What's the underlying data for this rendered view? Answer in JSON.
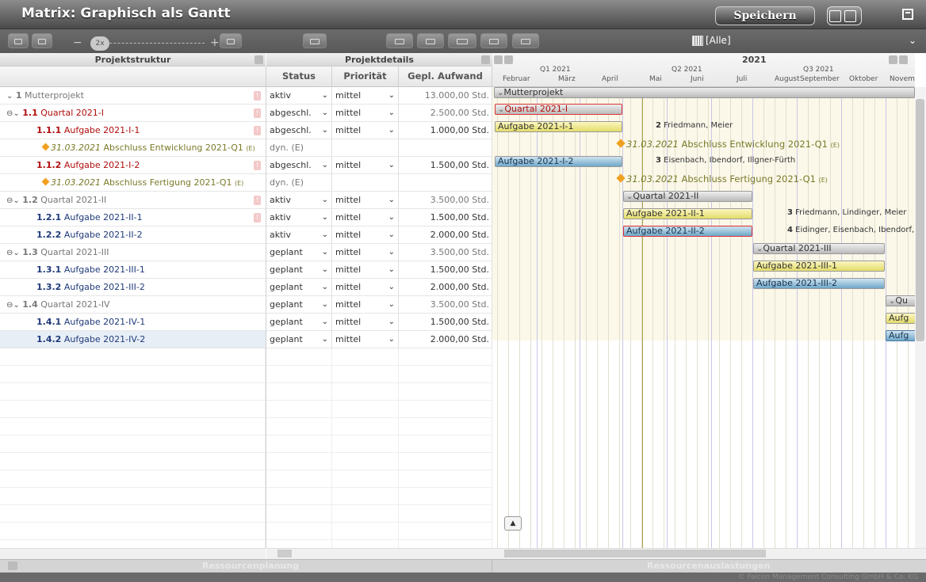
{
  "app": {
    "title": "Matrix: Graphisch als Gantt",
    "save_label": "Speichern",
    "filter_value": "[Alle]",
    "zoom_label": "2x",
    "zoom_minus": "−",
    "zoom_plus": "+"
  },
  "panels": {
    "structure_title": "Projektstruktur",
    "details_title": "Projektdetails",
    "year_label": "2021"
  },
  "columns": {
    "status": "Status",
    "priority": "Priorität",
    "effort": "Gepl. Aufwand"
  },
  "timeline": {
    "quarters": [
      "Q1 2021",
      "Q2 2021",
      "Q3 2021"
    ],
    "months": [
      "Februar",
      "März",
      "April",
      "Mai",
      "Juni",
      "Juli",
      "August",
      "September",
      "Oktober",
      "Novem"
    ]
  },
  "rows": [
    {
      "num": "1",
      "label": "Mutterprojekt",
      "status": "aktiv",
      "priority": "mittel",
      "effort": "13.000,00 Std."
    },
    {
      "num": "1.1",
      "label": "Quartal 2021-I",
      "status": "abgeschl.",
      "priority": "mittel",
      "effort": "2.500,00 Std."
    },
    {
      "num": "1.1.1",
      "label": "Aufgabe 2021-I-1",
      "status": "abgeschl.",
      "priority": "mittel",
      "effort": "1.000,00 Std."
    },
    {
      "date": "31.03.2021",
      "label": "Abschluss Entwicklung 2021-Q1",
      "suffix": "(E)",
      "status": "dyn. (E)"
    },
    {
      "num": "1.1.2",
      "label": "Aufgabe 2021-I-2",
      "status": "abgeschl.",
      "priority": "mittel",
      "effort": "1.500,00 Std."
    },
    {
      "date": "31.03.2021",
      "label": "Abschluss Fertigung 2021-Q1",
      "suffix": "(E)",
      "status": "dyn. (E)"
    },
    {
      "num": "1.2",
      "label": "Quartal 2021-II",
      "status": "aktiv",
      "priority": "mittel",
      "effort": "3.500,00 Std."
    },
    {
      "num": "1.2.1",
      "label": "Aufgabe 2021-II-1",
      "status": "aktiv",
      "priority": "mittel",
      "effort": "1.500,00 Std."
    },
    {
      "num": "1.2.2",
      "label": "Aufgabe 2021-II-2",
      "status": "aktiv",
      "priority": "mittel",
      "effort": "2.000,00 Std."
    },
    {
      "num": "1.3",
      "label": "Quartal 2021-III",
      "status": "geplant",
      "priority": "mittel",
      "effort": "3.500,00 Std."
    },
    {
      "num": "1.3.1",
      "label": "Aufgabe 2021-III-1",
      "status": "geplant",
      "priority": "mittel",
      "effort": "1.500,00 Std."
    },
    {
      "num": "1.3.2",
      "label": "Aufgabe 2021-III-2",
      "status": "geplant",
      "priority": "mittel",
      "effort": "2.000,00 Std."
    },
    {
      "num": "1.4",
      "label": "Quartal 2021-IV",
      "status": "geplant",
      "priority": "mittel",
      "effort": "3.500,00 Std."
    },
    {
      "num": "1.4.1",
      "label": "Aufgabe 2021-IV-1",
      "status": "geplant",
      "priority": "mittel",
      "effort": "1.500,00 Std."
    },
    {
      "num": "1.4.2",
      "label": "Aufgabe 2021-IV-2",
      "status": "geplant",
      "priority": "mittel",
      "effort": "2.000,00 Std."
    }
  ],
  "gantt": {
    "bars": {
      "mutter": "Mutterprojekt",
      "q1": "Quartal 2021-I",
      "a111": "Aufgabe 2021-I-1",
      "a112": "Aufgabe 2021-I-2",
      "q2": "Quartal 2021-II",
      "a121": "Aufgabe 2021-II-1",
      "a122": "Aufgabe 2021-II-2",
      "q3": "Quartal 2021-III",
      "a131": "Aufgabe 2021-III-1",
      "a132": "Aufgabe 2021-III-2",
      "q4": "Qu",
      "a141": "Aufg",
      "a142": "Aufg"
    },
    "resources": {
      "a111": {
        "count": "2",
        "names": "Friedmann, Meier"
      },
      "a112": {
        "count": "3",
        "names": "Eisenbach, Ibendorf, Illgner-Fürth"
      },
      "a121": {
        "count": "3",
        "names": "Friedmann, Lindinger, Meier"
      },
      "a122": {
        "count": "4",
        "names": "Eidinger, Eisenbach, Ibendorf,"
      }
    },
    "milestones": {
      "m1": {
        "date": "31.03.2021",
        "label": "Abschluss Entwicklung 2021-Q1",
        "suffix": "(E)"
      },
      "m2": {
        "date": "31.03.2021",
        "label": "Abschluss Fertigung 2021-Q1",
        "suffix": "(E)"
      }
    }
  },
  "footer": {
    "left": "Ressourcenplanung",
    "right": "Ressourcenauslastungen",
    "copyright": "© Falcon Management Consulting GmbH & Co. KG"
  },
  "colors": {
    "accent_red": "#b00d0d",
    "task_yellow": "#e3dc6a",
    "task_blue": "#6fa8c8",
    "milestone_orange": "#f0a020"
  }
}
